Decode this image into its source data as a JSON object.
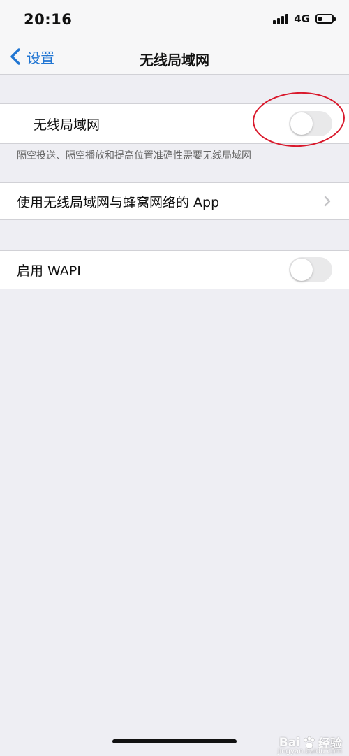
{
  "status_bar": {
    "time": "20:16",
    "network_type": "4G",
    "signal_icon": "signal-bars-icon",
    "battery_icon": "battery-icon",
    "battery_level": 0.25
  },
  "nav": {
    "back_label": "设置",
    "back_icon": "chevron-left-icon",
    "title": "无线局域网"
  },
  "wifi_section": {
    "label": "无线局域网",
    "toggle_on": false,
    "footer": "隔空投送、隔空播放和提高位置准确性需要无线局域网"
  },
  "apps_section": {
    "label": "使用无线局域网与蜂窝网络的 App",
    "chevron_icon": "chevron-right-icon"
  },
  "wapi_section": {
    "label": "启用 WAPI",
    "toggle_on": false
  },
  "annotation": {
    "color": "#d9182b"
  },
  "watermark": {
    "brand": "Bai",
    "brand_tail": "经验",
    "sub": "jingyan.baidu.com"
  },
  "colors": {
    "accent": "#2176d3",
    "background": "#eeeef3",
    "toggle_off": "#e9e9ea"
  }
}
